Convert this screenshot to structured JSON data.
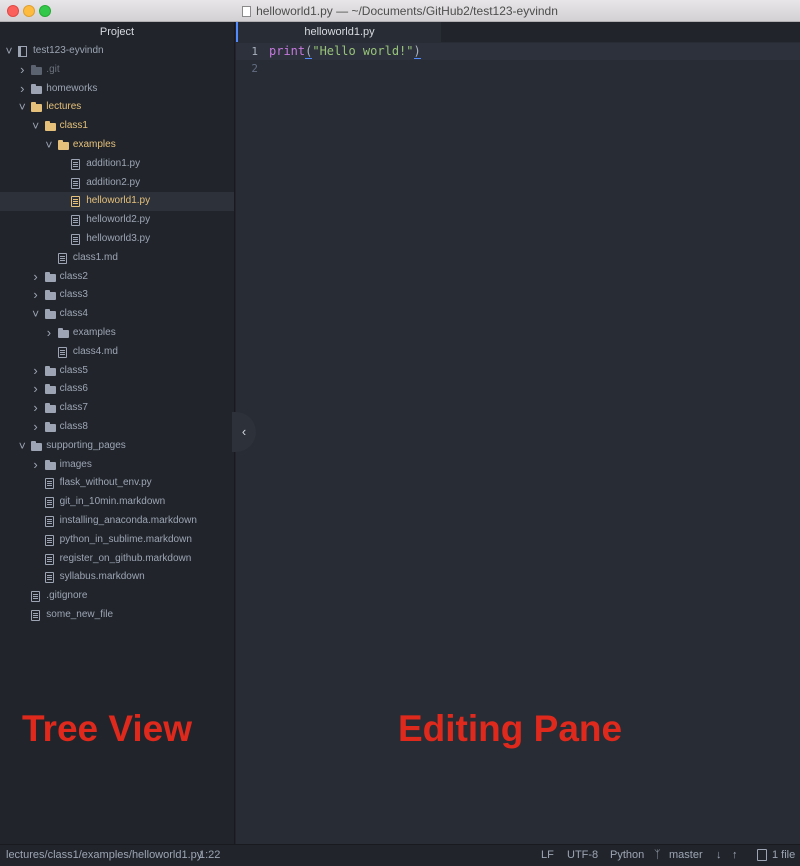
{
  "window": {
    "title": "helloworld1.py — ~/Documents/GitHub2/test123-eyvindn"
  },
  "tree_view": {
    "header": "Project",
    "items": [
      {
        "label": "test123-eyvindn",
        "kind": "repo",
        "depth": 0,
        "expanded": true
      },
      {
        "label": ".git",
        "kind": "folder",
        "depth": 1,
        "expanded": false,
        "muted": true
      },
      {
        "label": "homeworks",
        "kind": "folder",
        "depth": 1,
        "expanded": false
      },
      {
        "label": "lectures",
        "kind": "folder",
        "depth": 1,
        "expanded": true,
        "highlight": true
      },
      {
        "label": "class1",
        "kind": "folder",
        "depth": 2,
        "expanded": true,
        "highlight": true
      },
      {
        "label": "examples",
        "kind": "folder",
        "depth": 3,
        "expanded": true,
        "highlight": true
      },
      {
        "label": "addition1.py",
        "kind": "file",
        "depth": 4
      },
      {
        "label": "addition2.py",
        "kind": "file",
        "depth": 4
      },
      {
        "label": "helloworld1.py",
        "kind": "file",
        "depth": 4,
        "highlight": true,
        "selected": true
      },
      {
        "label": "helloworld2.py",
        "kind": "file",
        "depth": 4
      },
      {
        "label": "helloworld3.py",
        "kind": "file",
        "depth": 4
      },
      {
        "label": "class1.md",
        "kind": "file",
        "depth": 3
      },
      {
        "label": "class2",
        "kind": "folder",
        "depth": 2,
        "expanded": false
      },
      {
        "label": "class3",
        "kind": "folder",
        "depth": 2,
        "expanded": false
      },
      {
        "label": "class4",
        "kind": "folder",
        "depth": 2,
        "expanded": true
      },
      {
        "label": "examples",
        "kind": "folder",
        "depth": 3,
        "expanded": false
      },
      {
        "label": "class4.md",
        "kind": "file",
        "depth": 3
      },
      {
        "label": "class5",
        "kind": "folder",
        "depth": 2,
        "expanded": false
      },
      {
        "label": "class6",
        "kind": "folder",
        "depth": 2,
        "expanded": false
      },
      {
        "label": "class7",
        "kind": "folder",
        "depth": 2,
        "expanded": false
      },
      {
        "label": "class8",
        "kind": "folder",
        "depth": 2,
        "expanded": false
      },
      {
        "label": "supporting_pages",
        "kind": "folder",
        "depth": 1,
        "expanded": true
      },
      {
        "label": "images",
        "kind": "folder",
        "depth": 2,
        "expanded": false
      },
      {
        "label": "flask_without_env.py",
        "kind": "file",
        "depth": 2
      },
      {
        "label": "git_in_10min.markdown",
        "kind": "file",
        "depth": 2
      },
      {
        "label": "installing_anaconda.markdown",
        "kind": "file",
        "depth": 2
      },
      {
        "label": "python_in_sublime.markdown",
        "kind": "file",
        "depth": 2
      },
      {
        "label": "register_on_github.markdown",
        "kind": "file",
        "depth": 2
      },
      {
        "label": "syllabus.markdown",
        "kind": "file",
        "depth": 2
      },
      {
        "label": ".gitignore",
        "kind": "file",
        "depth": 1
      },
      {
        "label": "some_new_file",
        "kind": "file",
        "depth": 1
      }
    ]
  },
  "editor": {
    "tab_label": "helloworld1.py",
    "lines": [
      {
        "number": "1",
        "tokens": [
          {
            "text": "print",
            "cls": "kw"
          },
          {
            "text": "(",
            "cls": "punc bracket-mark"
          },
          {
            "text": "\"Hello world!\"",
            "cls": "str"
          },
          {
            "text": ")",
            "cls": "punc bracket-mark"
          }
        ]
      },
      {
        "number": "2",
        "tokens": []
      }
    ]
  },
  "annotations": {
    "tree_view": "Tree View",
    "editing_pane": "Editing Pane"
  },
  "status_bar": {
    "path": "lectures/class1/examples/helloworld1.py",
    "cursor": "1:22",
    "line_ending": "LF",
    "encoding": "UTF-8",
    "grammar": "Python",
    "branch": "master",
    "files_changed": "1 file"
  },
  "colors": {
    "highlight": "#e5c07b",
    "accent": "#528bff",
    "annotation_red": "#e0291d"
  }
}
